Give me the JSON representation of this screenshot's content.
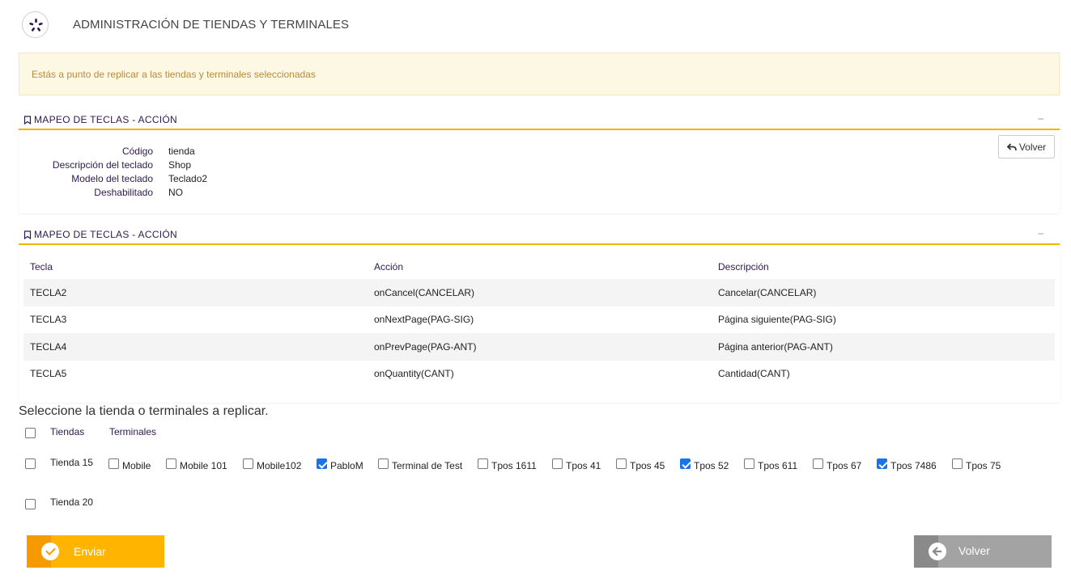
{
  "header": {
    "title": "ADMINISTRACIÓN DE TIENDAS Y TERMINALES",
    "logo_icon": "spinner-logo-icon"
  },
  "alert": {
    "message": "Estás a punto de replicar a las tiendas y terminales seleccionadas"
  },
  "panel1": {
    "title": "MAPEO DE TECLAS - ACCIÓN",
    "collapse": "–",
    "back_button": "Volver",
    "fields": [
      {
        "label": "Código",
        "value": "tienda"
      },
      {
        "label": "Descripción del teclado",
        "value": "Shop"
      },
      {
        "label": "Modelo del teclado",
        "value": "Teclado2"
      },
      {
        "label": "Deshabilitado",
        "value": "NO"
      }
    ]
  },
  "panel2": {
    "title": "MAPEO DE TECLAS - ACCIÓN",
    "collapse": "–",
    "columns": [
      "Tecla",
      "Acción",
      "Descripción"
    ],
    "rows": [
      [
        "TECLA2",
        "onCancel(CANCELAR)",
        "Cancelar(CANCELAR)"
      ],
      [
        "TECLA3",
        "onNextPage(PAG-SIG)",
        "Página siguiente(PAG-SIG)"
      ],
      [
        "TECLA4",
        "onPrevPage(PAG-ANT)",
        "Página anterior(PAG-ANT)"
      ],
      [
        "TECLA5",
        "onQuantity(CANT)",
        "Cantidad(CANT)"
      ]
    ]
  },
  "selection": {
    "title": "Seleccione la tienda o terminales a replicar.",
    "col_tiendas": "Tiendas",
    "col_terminales": "Terminales",
    "stores": [
      {
        "name": "Tienda 15",
        "checked": false,
        "terminals": [
          {
            "name": "Mobile",
            "checked": false
          },
          {
            "name": "Mobile 101",
            "checked": false
          },
          {
            "name": "Mobile102",
            "checked": false
          },
          {
            "name": "PabloM",
            "checked": true
          },
          {
            "name": "Terminal de Test",
            "checked": false
          },
          {
            "name": "Tpos 1611",
            "checked": false
          },
          {
            "name": "Tpos 41",
            "checked": false
          },
          {
            "name": "Tpos 45",
            "checked": false
          },
          {
            "name": "Tpos 52",
            "checked": true
          },
          {
            "name": "Tpos 611",
            "checked": false
          },
          {
            "name": "Tpos 67",
            "checked": false
          },
          {
            "name": "Tpos 7486",
            "checked": true
          },
          {
            "name": "Tpos 75",
            "checked": false
          }
        ]
      },
      {
        "name": "Tienda 20",
        "checked": false,
        "terminals": []
      }
    ]
  },
  "actions": {
    "send_label": "Enviar",
    "back_label": "Volver"
  },
  "colors": {
    "accent": "#ffb400",
    "alert_bg": "#fcf8e3",
    "alert_text": "#b98b3c",
    "heading": "#2d1a4e",
    "checkbox_checked": "#1a73e8",
    "back_button": "#a3a3a3"
  }
}
